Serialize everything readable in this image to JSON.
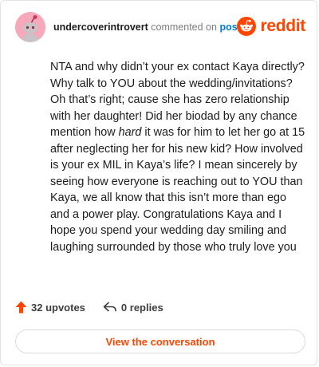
{
  "comment": {
    "username": "undercoverintrovert",
    "action": "commented on",
    "post_link": "post",
    "brand": "reddit",
    "body_before_emphasis": "NTA and why didn’t your ex contact Kaya directly? Why talk to YOU about the wedding/invitations? Oh that’s right; cause she has zero relationship with her daughter! Did her biodad by any chance mention how ",
    "body_emphasis": "hard",
    "body_after_emphasis": " it was for him to let her go at 15 after neglecting her for his new kid? How involved is your ex MIL in Kaya’s life? I mean sincerely by seeing how everyone is reaching out to YOU than Kaya, we all know that this isn’t more than ego and a power play. Congratulations Kaya and I hope you spend your wedding day smiling and laughing surrounded by those who truly love you",
    "upvotes": "32 upvotes",
    "replies": "0 replies",
    "cta": "View the conversation"
  },
  "icons": {
    "avatar": "snoo-avatar",
    "logo": "reddit-snoo-logo",
    "upvote": "upvote-arrow-icon",
    "reply": "reply-arrow-icon"
  },
  "colors": {
    "brand": "#ff4500",
    "link": "#0079d3",
    "avatar_bg": "#f7a8bb",
    "text": "#1c1c1c",
    "muted": "#7c7c7c"
  }
}
